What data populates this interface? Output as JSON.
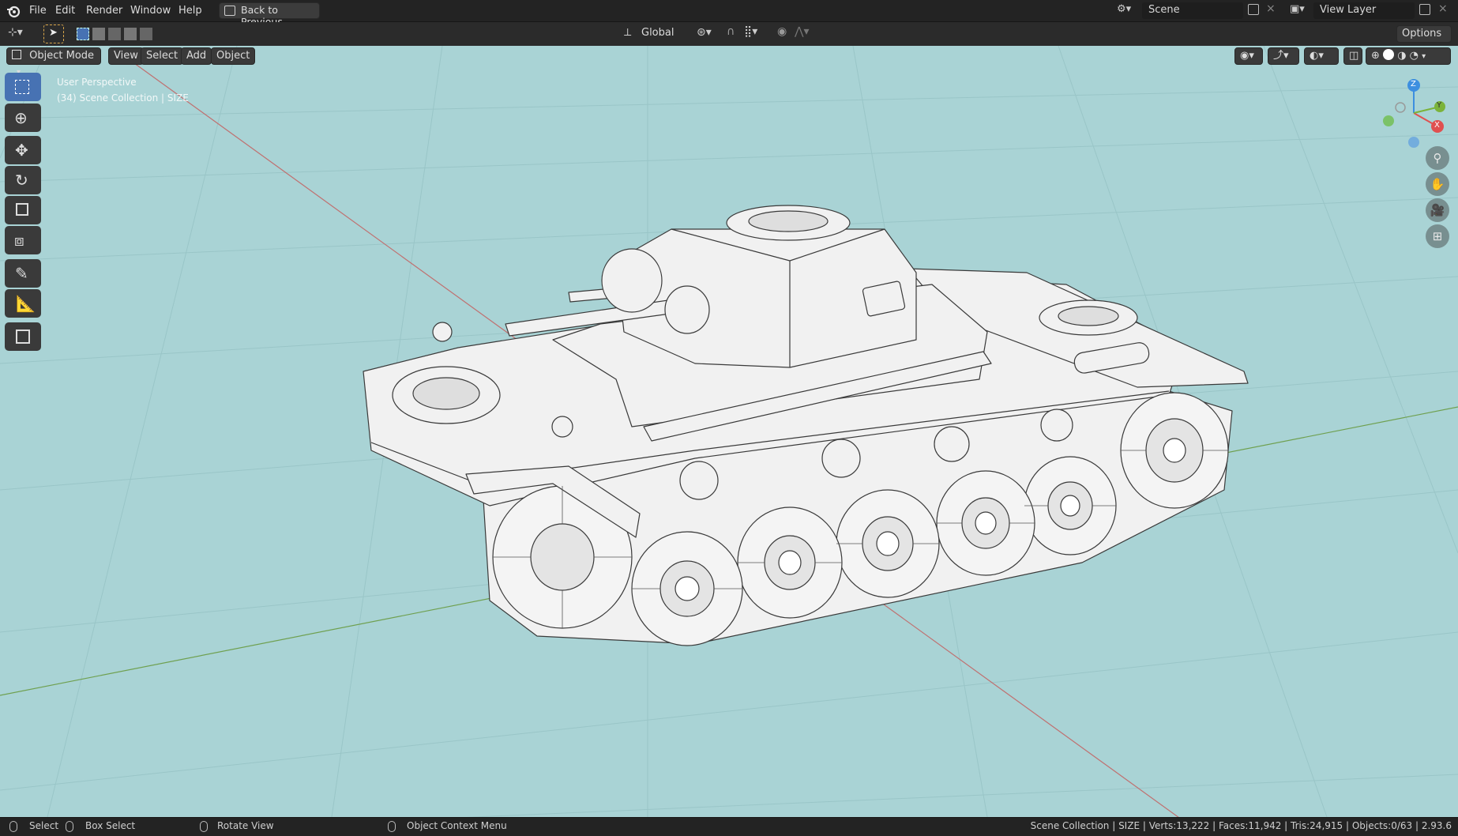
{
  "app": {
    "menu": [
      "File",
      "Edit",
      "Render",
      "Window",
      "Help"
    ],
    "back_button": "Back to Previous",
    "scene_label": "Scene",
    "view_layer_label": "View Layer"
  },
  "header": {
    "orientation": "Global",
    "options_label": "Options"
  },
  "viewport_header": {
    "mode": "Object Mode",
    "menus": [
      "View",
      "Select",
      "Add",
      "Object"
    ]
  },
  "overlay_text": {
    "perspective": "User Perspective",
    "collection": "(34) Scene Collection | SIZE"
  },
  "gizmo": {
    "x": "X",
    "y": "Y",
    "z": "Z"
  },
  "statusbar": {
    "select": "Select",
    "box_select": "Box Select",
    "rotate_view": "Rotate View",
    "context_menu": "Object Context Menu",
    "stats": "Scene Collection | SIZE | Verts:13,222 | Faces:11,942 | Tris:24,915 | Objects:0/63 | 2.93.6"
  },
  "colors": {
    "viewport_bg": "#a9d3d5",
    "accent": "#4772b3",
    "x_axis": "#e05050",
    "y_axis": "#7bb33a",
    "z_axis": "#3d8fe0"
  }
}
